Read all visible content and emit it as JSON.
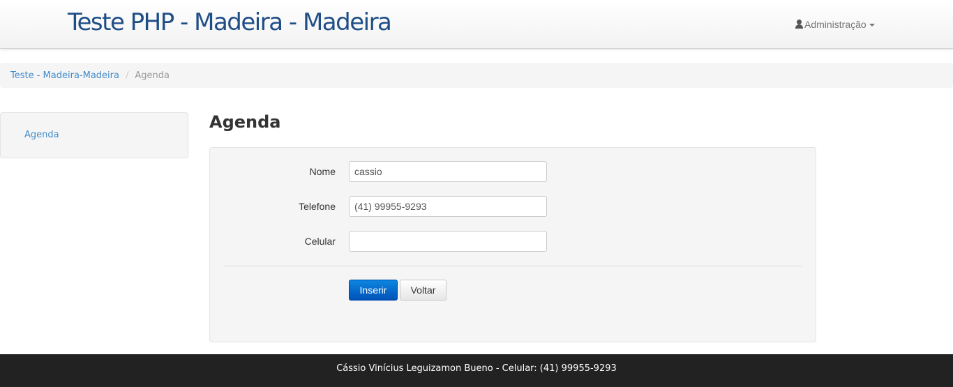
{
  "header": {
    "brand": "Teste PHP - Madeira - Madeira",
    "admin_label": "Administração"
  },
  "icons": {
    "user": "user-icon",
    "caret": "caret-down-icon"
  },
  "breadcrumb": {
    "home": "Teste - Madeira-Madeira",
    "separator": "/",
    "current": "Agenda"
  },
  "sidebar": {
    "items": [
      {
        "label": "Agenda"
      }
    ]
  },
  "main": {
    "title": "Agenda",
    "form": {
      "nome_label": "Nome",
      "nome_value": "cassio",
      "telefone_label": "Telefone",
      "telefone_value": "(41) 99955-9293",
      "celular_label": "Celular",
      "celular_value": "",
      "submit_label": "Inserir",
      "back_label": "Voltar"
    }
  },
  "footer": {
    "text": "Cássio Vinícius Leguizamon Bueno - Celular: (41) 99955-9293"
  },
  "colors": {
    "brand": "#1f4e86",
    "link": "#428bca",
    "primary_button": "#0066cc",
    "footer_bg": "#222222"
  }
}
